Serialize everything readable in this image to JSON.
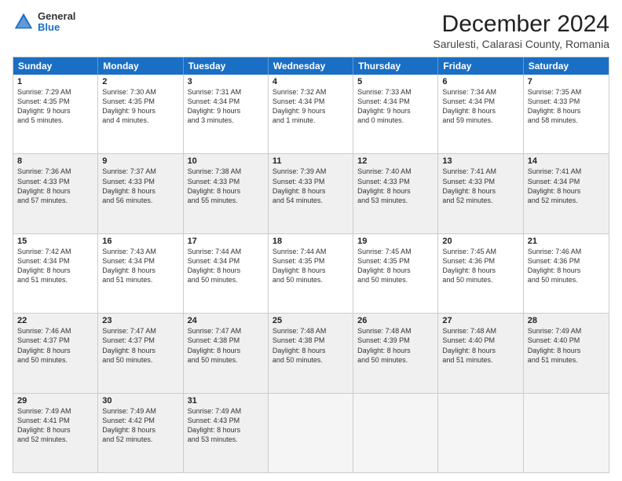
{
  "header": {
    "logo_general": "General",
    "logo_blue": "Blue",
    "title": "December 2024",
    "subtitle": "Sarulesti, Calarasi County, Romania"
  },
  "weekdays": [
    "Sunday",
    "Monday",
    "Tuesday",
    "Wednesday",
    "Thursday",
    "Friday",
    "Saturday"
  ],
  "rows": [
    [
      {
        "day": "1",
        "lines": [
          "Sunrise: 7:29 AM",
          "Sunset: 4:35 PM",
          "Daylight: 9 hours",
          "and 5 minutes."
        ]
      },
      {
        "day": "2",
        "lines": [
          "Sunrise: 7:30 AM",
          "Sunset: 4:35 PM",
          "Daylight: 9 hours",
          "and 4 minutes."
        ]
      },
      {
        "day": "3",
        "lines": [
          "Sunrise: 7:31 AM",
          "Sunset: 4:34 PM",
          "Daylight: 9 hours",
          "and 3 minutes."
        ]
      },
      {
        "day": "4",
        "lines": [
          "Sunrise: 7:32 AM",
          "Sunset: 4:34 PM",
          "Daylight: 9 hours",
          "and 1 minute."
        ]
      },
      {
        "day": "5",
        "lines": [
          "Sunrise: 7:33 AM",
          "Sunset: 4:34 PM",
          "Daylight: 9 hours",
          "and 0 minutes."
        ]
      },
      {
        "day": "6",
        "lines": [
          "Sunrise: 7:34 AM",
          "Sunset: 4:34 PM",
          "Daylight: 8 hours",
          "and 59 minutes."
        ]
      },
      {
        "day": "7",
        "lines": [
          "Sunrise: 7:35 AM",
          "Sunset: 4:33 PM",
          "Daylight: 8 hours",
          "and 58 minutes."
        ]
      }
    ],
    [
      {
        "day": "8",
        "lines": [
          "Sunrise: 7:36 AM",
          "Sunset: 4:33 PM",
          "Daylight: 8 hours",
          "and 57 minutes."
        ]
      },
      {
        "day": "9",
        "lines": [
          "Sunrise: 7:37 AM",
          "Sunset: 4:33 PM",
          "Daylight: 8 hours",
          "and 56 minutes."
        ]
      },
      {
        "day": "10",
        "lines": [
          "Sunrise: 7:38 AM",
          "Sunset: 4:33 PM",
          "Daylight: 8 hours",
          "and 55 minutes."
        ]
      },
      {
        "day": "11",
        "lines": [
          "Sunrise: 7:39 AM",
          "Sunset: 4:33 PM",
          "Daylight: 8 hours",
          "and 54 minutes."
        ]
      },
      {
        "day": "12",
        "lines": [
          "Sunrise: 7:40 AM",
          "Sunset: 4:33 PM",
          "Daylight: 8 hours",
          "and 53 minutes."
        ]
      },
      {
        "day": "13",
        "lines": [
          "Sunrise: 7:41 AM",
          "Sunset: 4:33 PM",
          "Daylight: 8 hours",
          "and 52 minutes."
        ]
      },
      {
        "day": "14",
        "lines": [
          "Sunrise: 7:41 AM",
          "Sunset: 4:34 PM",
          "Daylight: 8 hours",
          "and 52 minutes."
        ]
      }
    ],
    [
      {
        "day": "15",
        "lines": [
          "Sunrise: 7:42 AM",
          "Sunset: 4:34 PM",
          "Daylight: 8 hours",
          "and 51 minutes."
        ]
      },
      {
        "day": "16",
        "lines": [
          "Sunrise: 7:43 AM",
          "Sunset: 4:34 PM",
          "Daylight: 8 hours",
          "and 51 minutes."
        ]
      },
      {
        "day": "17",
        "lines": [
          "Sunrise: 7:44 AM",
          "Sunset: 4:34 PM",
          "Daylight: 8 hours",
          "and 50 minutes."
        ]
      },
      {
        "day": "18",
        "lines": [
          "Sunrise: 7:44 AM",
          "Sunset: 4:35 PM",
          "Daylight: 8 hours",
          "and 50 minutes."
        ]
      },
      {
        "day": "19",
        "lines": [
          "Sunrise: 7:45 AM",
          "Sunset: 4:35 PM",
          "Daylight: 8 hours",
          "and 50 minutes."
        ]
      },
      {
        "day": "20",
        "lines": [
          "Sunrise: 7:45 AM",
          "Sunset: 4:36 PM",
          "Daylight: 8 hours",
          "and 50 minutes."
        ]
      },
      {
        "day": "21",
        "lines": [
          "Sunrise: 7:46 AM",
          "Sunset: 4:36 PM",
          "Daylight: 8 hours",
          "and 50 minutes."
        ]
      }
    ],
    [
      {
        "day": "22",
        "lines": [
          "Sunrise: 7:46 AM",
          "Sunset: 4:37 PM",
          "Daylight: 8 hours",
          "and 50 minutes."
        ]
      },
      {
        "day": "23",
        "lines": [
          "Sunrise: 7:47 AM",
          "Sunset: 4:37 PM",
          "Daylight: 8 hours",
          "and 50 minutes."
        ]
      },
      {
        "day": "24",
        "lines": [
          "Sunrise: 7:47 AM",
          "Sunset: 4:38 PM",
          "Daylight: 8 hours",
          "and 50 minutes."
        ]
      },
      {
        "day": "25",
        "lines": [
          "Sunrise: 7:48 AM",
          "Sunset: 4:38 PM",
          "Daylight: 8 hours",
          "and 50 minutes."
        ]
      },
      {
        "day": "26",
        "lines": [
          "Sunrise: 7:48 AM",
          "Sunset: 4:39 PM",
          "Daylight: 8 hours",
          "and 50 minutes."
        ]
      },
      {
        "day": "27",
        "lines": [
          "Sunrise: 7:48 AM",
          "Sunset: 4:40 PM",
          "Daylight: 8 hours",
          "and 51 minutes."
        ]
      },
      {
        "day": "28",
        "lines": [
          "Sunrise: 7:49 AM",
          "Sunset: 4:40 PM",
          "Daylight: 8 hours",
          "and 51 minutes."
        ]
      }
    ],
    [
      {
        "day": "29",
        "lines": [
          "Sunrise: 7:49 AM",
          "Sunset: 4:41 PM",
          "Daylight: 8 hours",
          "and 52 minutes."
        ]
      },
      {
        "day": "30",
        "lines": [
          "Sunrise: 7:49 AM",
          "Sunset: 4:42 PM",
          "Daylight: 8 hours",
          "and 52 minutes."
        ]
      },
      {
        "day": "31",
        "lines": [
          "Sunrise: 7:49 AM",
          "Sunset: 4:43 PM",
          "Daylight: 8 hours",
          "and 53 minutes."
        ]
      },
      null,
      null,
      null,
      null
    ]
  ]
}
